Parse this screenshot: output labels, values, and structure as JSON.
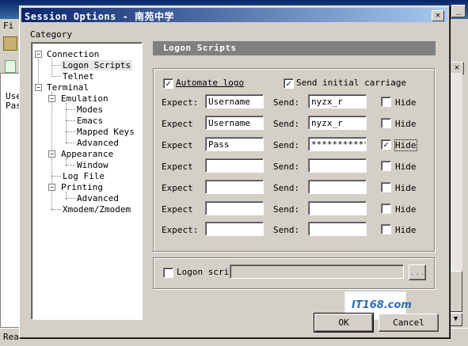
{
  "background_app": {
    "menu_fragment": "Fi",
    "client_lines": [
      "Use",
      "Pas"
    ],
    "status": "Rea"
  },
  "dialog": {
    "title": "Session Options - 南苑中学",
    "category_label": "Category",
    "tree": [
      {
        "label": "Connection",
        "expander": "−"
      },
      {
        "label": "Logon Scripts",
        "selected": true
      },
      {
        "label": "Telnet"
      },
      {
        "label": "Terminal",
        "expander": "−"
      },
      {
        "label": "Emulation",
        "expander": "−"
      },
      {
        "label": "Modes"
      },
      {
        "label": "Emacs"
      },
      {
        "label": "Mapped Keys"
      },
      {
        "label": "Advanced"
      },
      {
        "label": "Appearance",
        "expander": "−"
      },
      {
        "label": "Window"
      },
      {
        "label": "Log File"
      },
      {
        "label": "Printing",
        "expander": "−"
      },
      {
        "label": "Advanced"
      },
      {
        "label": "Xmodem/Zmodem"
      }
    ],
    "panel_title": "Logon Scripts",
    "automate_logon": {
      "label": "Automate logo",
      "checked": true
    },
    "send_initial_carriage": {
      "label": "Send initial carriage",
      "checked": true
    },
    "rows": [
      {
        "expect_label": "Expect:",
        "expect": "Username",
        "send_label": "Send:",
        "send": "nyzx_r",
        "hide_label": "Hide",
        "hide": false
      },
      {
        "expect_label": "Expect",
        "expect": "Username",
        "send_label": "Send:",
        "send": "nyzx_r",
        "hide_label": "Hide",
        "hide": false
      },
      {
        "expect_label": "Expect",
        "expect": "Pass",
        "send_label": "Send:",
        "send": "************",
        "hide_label": "Hide",
        "hide": true
      },
      {
        "expect_label": "Expect",
        "expect": "",
        "send_label": "Send:",
        "send": "",
        "hide_label": "Hide",
        "hide": false
      },
      {
        "expect_label": "Expect",
        "expect": "",
        "send_label": "Send:",
        "send": "",
        "hide_label": "Hide",
        "hide": false
      },
      {
        "expect_label": "Expect",
        "expect": "",
        "send_label": "Send:",
        "send": "",
        "hide_label": "Hide",
        "hide": false
      },
      {
        "expect_label": "Expect:",
        "expect": "",
        "send_label": "Send:",
        "send": "",
        "hide_label": "Hide",
        "hide": false
      }
    ],
    "logon_script": {
      "label": "Logon scrip",
      "checked": false,
      "path": "",
      "browse_label": "..."
    },
    "ok_label": "OK",
    "cancel_label": "Cancel",
    "watermark": "IT168.com"
  },
  "colors": {
    "titlebar": "#0a246a",
    "face": "#d4d0c8",
    "panel_header": "#808080"
  }
}
